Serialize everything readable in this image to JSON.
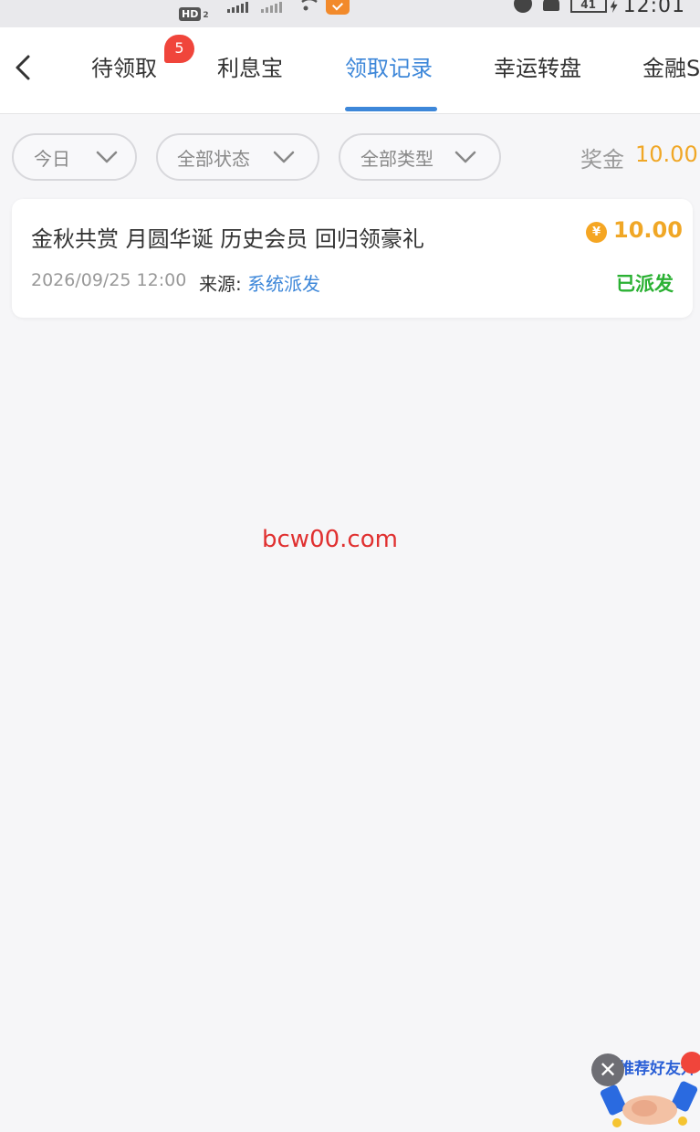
{
  "status_bar": {
    "hd_label": "HD",
    "hd_sub": "2",
    "battery": "41",
    "time": "12:01"
  },
  "nav": {
    "tabs": [
      {
        "label": "待领取",
        "badge": "5",
        "active": false
      },
      {
        "label": "利息宝",
        "active": false
      },
      {
        "label": "领取记录",
        "active": true
      },
      {
        "label": "幸运转盘",
        "active": false
      },
      {
        "label": "金融S",
        "active": false
      }
    ]
  },
  "filters": {
    "date": "今日",
    "status": "全部状态",
    "type": "全部类型",
    "bonus_label": "奖金",
    "bonus_value": "10.00"
  },
  "records": [
    {
      "title": "金秋共赏 月圆华诞 历史会员 回归领豪礼",
      "currency_symbol": "¥",
      "amount": "10.00",
      "datetime": "2026/09/25 12:00",
      "source_label": "来源:",
      "source_value": "系统派发",
      "status": "已派发"
    }
  ],
  "watermark": "bcw00.com",
  "promo": {
    "close_glyph": "✕",
    "text": "推荐好友升"
  },
  "colors": {
    "accent": "#3d87d9",
    "bonus": "#f0a726",
    "success": "#2bb133",
    "badge": "#f0453b",
    "watermark": "#e03030"
  }
}
